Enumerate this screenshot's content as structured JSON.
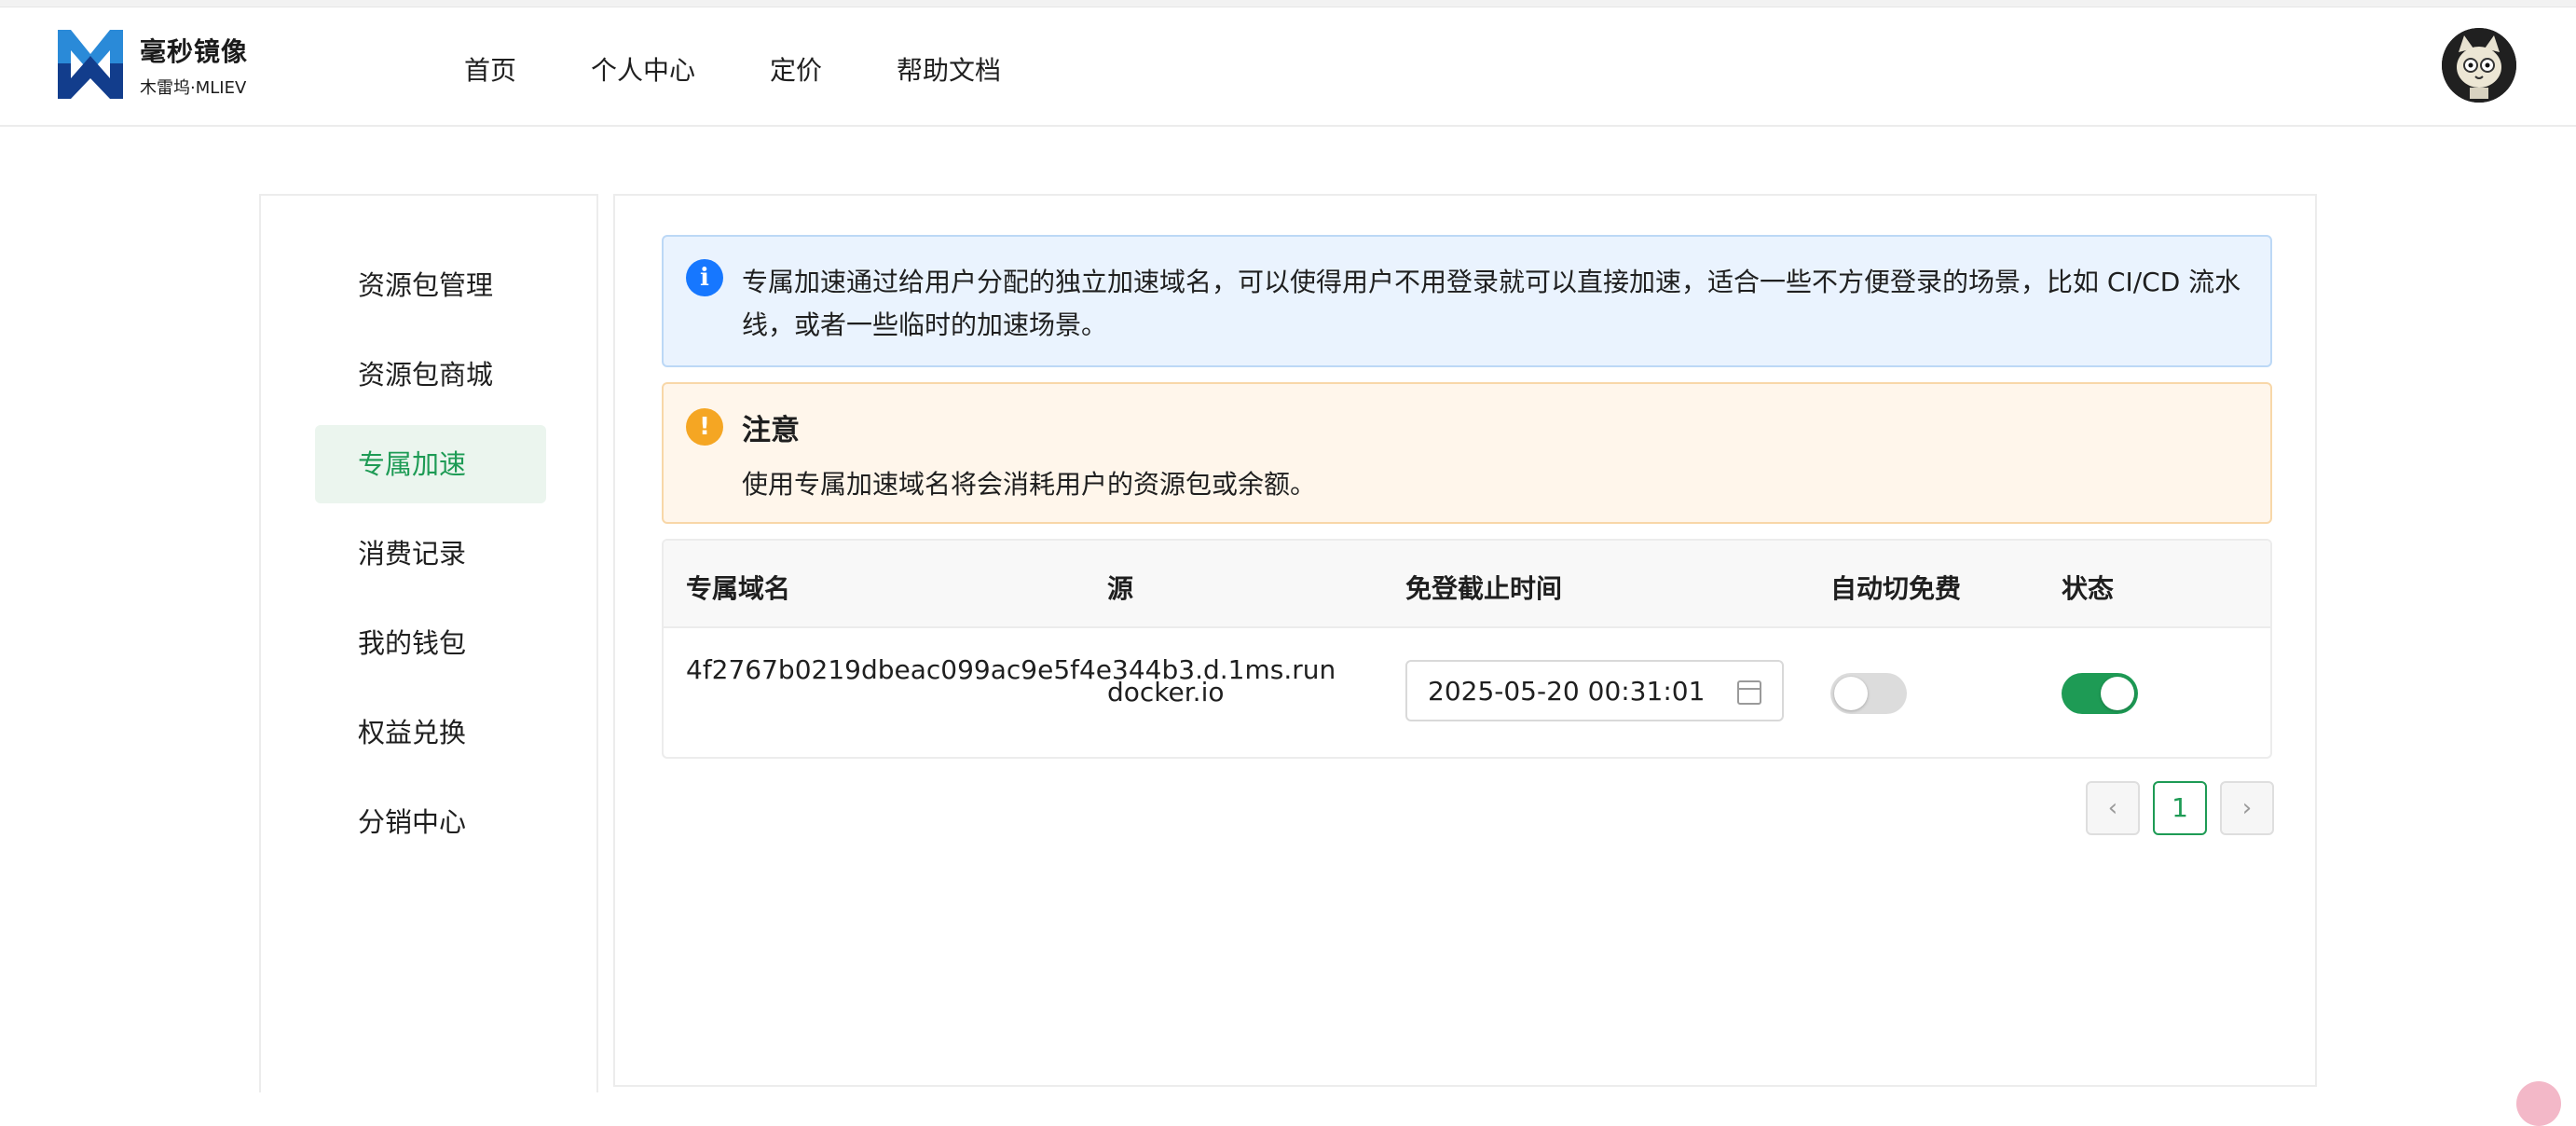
{
  "header": {
    "brand_name": "毫秒镜像",
    "brand_sub": "木雷坞·MLIEV",
    "nav": [
      "首页",
      "个人中心",
      "定价",
      "帮助文档"
    ]
  },
  "sidebar": {
    "items": [
      {
        "label": "资源包管理",
        "active": false
      },
      {
        "label": "资源包商城",
        "active": false
      },
      {
        "label": "专属加速",
        "active": true
      },
      {
        "label": "消费记录",
        "active": false
      },
      {
        "label": "我的钱包",
        "active": false
      },
      {
        "label": "权益兑换",
        "active": false
      },
      {
        "label": "分销中心",
        "active": false
      }
    ]
  },
  "info_alert": {
    "icon": "info-icon",
    "text": "专属加速通过给用户分配的独立加速域名，可以使得用户不用登录就可以直接加速，适合一些不方便登录的场景，比如 CI/CD 流水线，或者一些临时的加速场景。"
  },
  "warn_alert": {
    "icon": "warning-icon",
    "title": "注意",
    "text": "使用专属加速域名将会消耗用户的资源包或余额。"
  },
  "table": {
    "columns": [
      "专属域名",
      "源",
      "免登截止时间",
      "自动切免费",
      "状态"
    ],
    "rows": [
      {
        "domain": "4f2767b0219dbeac099ac9e5f4e344b3.d.1ms.run",
        "source": "docker.io",
        "expire": "2025-05-20 00:31:01",
        "auto_free": false,
        "status": true
      }
    ]
  },
  "pagination": {
    "prev": "‹",
    "current": "1",
    "next": "›"
  },
  "colors": {
    "accent": "#1e9b55",
    "info": "#1677ff",
    "warning": "#f5a623"
  }
}
